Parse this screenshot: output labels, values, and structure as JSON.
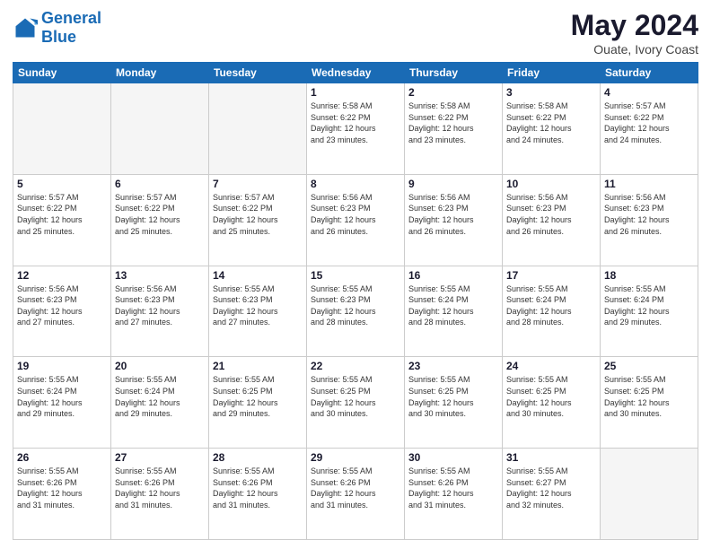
{
  "header": {
    "logo_general": "General",
    "logo_blue": "Blue",
    "title": "May 2024",
    "subtitle": "Ouate, Ivory Coast"
  },
  "weekdays": [
    "Sunday",
    "Monday",
    "Tuesday",
    "Wednesday",
    "Thursday",
    "Friday",
    "Saturday"
  ],
  "weeks": [
    [
      {
        "day": "",
        "info": ""
      },
      {
        "day": "",
        "info": ""
      },
      {
        "day": "",
        "info": ""
      },
      {
        "day": "1",
        "info": "Sunrise: 5:58 AM\nSunset: 6:22 PM\nDaylight: 12 hours\nand 23 minutes."
      },
      {
        "day": "2",
        "info": "Sunrise: 5:58 AM\nSunset: 6:22 PM\nDaylight: 12 hours\nand 23 minutes."
      },
      {
        "day": "3",
        "info": "Sunrise: 5:58 AM\nSunset: 6:22 PM\nDaylight: 12 hours\nand 24 minutes."
      },
      {
        "day": "4",
        "info": "Sunrise: 5:57 AM\nSunset: 6:22 PM\nDaylight: 12 hours\nand 24 minutes."
      }
    ],
    [
      {
        "day": "5",
        "info": "Sunrise: 5:57 AM\nSunset: 6:22 PM\nDaylight: 12 hours\nand 25 minutes."
      },
      {
        "day": "6",
        "info": "Sunrise: 5:57 AM\nSunset: 6:22 PM\nDaylight: 12 hours\nand 25 minutes."
      },
      {
        "day": "7",
        "info": "Sunrise: 5:57 AM\nSunset: 6:22 PM\nDaylight: 12 hours\nand 25 minutes."
      },
      {
        "day": "8",
        "info": "Sunrise: 5:56 AM\nSunset: 6:23 PM\nDaylight: 12 hours\nand 26 minutes."
      },
      {
        "day": "9",
        "info": "Sunrise: 5:56 AM\nSunset: 6:23 PM\nDaylight: 12 hours\nand 26 minutes."
      },
      {
        "day": "10",
        "info": "Sunrise: 5:56 AM\nSunset: 6:23 PM\nDaylight: 12 hours\nand 26 minutes."
      },
      {
        "day": "11",
        "info": "Sunrise: 5:56 AM\nSunset: 6:23 PM\nDaylight: 12 hours\nand 26 minutes."
      }
    ],
    [
      {
        "day": "12",
        "info": "Sunrise: 5:56 AM\nSunset: 6:23 PM\nDaylight: 12 hours\nand 27 minutes."
      },
      {
        "day": "13",
        "info": "Sunrise: 5:56 AM\nSunset: 6:23 PM\nDaylight: 12 hours\nand 27 minutes."
      },
      {
        "day": "14",
        "info": "Sunrise: 5:55 AM\nSunset: 6:23 PM\nDaylight: 12 hours\nand 27 minutes."
      },
      {
        "day": "15",
        "info": "Sunrise: 5:55 AM\nSunset: 6:23 PM\nDaylight: 12 hours\nand 28 minutes."
      },
      {
        "day": "16",
        "info": "Sunrise: 5:55 AM\nSunset: 6:24 PM\nDaylight: 12 hours\nand 28 minutes."
      },
      {
        "day": "17",
        "info": "Sunrise: 5:55 AM\nSunset: 6:24 PM\nDaylight: 12 hours\nand 28 minutes."
      },
      {
        "day": "18",
        "info": "Sunrise: 5:55 AM\nSunset: 6:24 PM\nDaylight: 12 hours\nand 29 minutes."
      }
    ],
    [
      {
        "day": "19",
        "info": "Sunrise: 5:55 AM\nSunset: 6:24 PM\nDaylight: 12 hours\nand 29 minutes."
      },
      {
        "day": "20",
        "info": "Sunrise: 5:55 AM\nSunset: 6:24 PM\nDaylight: 12 hours\nand 29 minutes."
      },
      {
        "day": "21",
        "info": "Sunrise: 5:55 AM\nSunset: 6:25 PM\nDaylight: 12 hours\nand 29 minutes."
      },
      {
        "day": "22",
        "info": "Sunrise: 5:55 AM\nSunset: 6:25 PM\nDaylight: 12 hours\nand 30 minutes."
      },
      {
        "day": "23",
        "info": "Sunrise: 5:55 AM\nSunset: 6:25 PM\nDaylight: 12 hours\nand 30 minutes."
      },
      {
        "day": "24",
        "info": "Sunrise: 5:55 AM\nSunset: 6:25 PM\nDaylight: 12 hours\nand 30 minutes."
      },
      {
        "day": "25",
        "info": "Sunrise: 5:55 AM\nSunset: 6:25 PM\nDaylight: 12 hours\nand 30 minutes."
      }
    ],
    [
      {
        "day": "26",
        "info": "Sunrise: 5:55 AM\nSunset: 6:26 PM\nDaylight: 12 hours\nand 31 minutes."
      },
      {
        "day": "27",
        "info": "Sunrise: 5:55 AM\nSunset: 6:26 PM\nDaylight: 12 hours\nand 31 minutes."
      },
      {
        "day": "28",
        "info": "Sunrise: 5:55 AM\nSunset: 6:26 PM\nDaylight: 12 hours\nand 31 minutes."
      },
      {
        "day": "29",
        "info": "Sunrise: 5:55 AM\nSunset: 6:26 PM\nDaylight: 12 hours\nand 31 minutes."
      },
      {
        "day": "30",
        "info": "Sunrise: 5:55 AM\nSunset: 6:26 PM\nDaylight: 12 hours\nand 31 minutes."
      },
      {
        "day": "31",
        "info": "Sunrise: 5:55 AM\nSunset: 6:27 PM\nDaylight: 12 hours\nand 32 minutes."
      },
      {
        "day": "",
        "info": ""
      }
    ]
  ]
}
